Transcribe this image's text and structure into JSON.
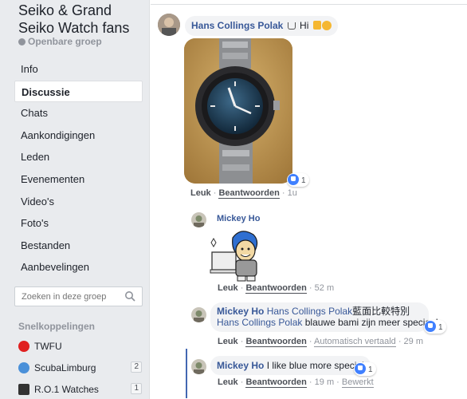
{
  "sidebar": {
    "group_title": "Seiko & Grand Seiko Watch fans",
    "group_type": "Openbare groep",
    "nav": [
      {
        "label": "Info",
        "active": false
      },
      {
        "label": "Discussie",
        "active": true
      },
      {
        "label": "Chats",
        "active": false
      },
      {
        "label": "Aankondigingen",
        "active": false
      },
      {
        "label": "Leden",
        "active": false
      },
      {
        "label": "Evenementen",
        "active": false
      },
      {
        "label": "Video's",
        "active": false
      },
      {
        "label": "Foto's",
        "active": false
      },
      {
        "label": "Bestanden",
        "active": false
      },
      {
        "label": "Aanbevelingen",
        "active": false
      }
    ],
    "search_placeholder": "Zoeken in deze groep",
    "shortcuts_heading": "Snelkoppelingen",
    "shortcuts": [
      {
        "label": "TWFU",
        "count": "",
        "color": "#e02020"
      },
      {
        "label": "ScubaLimburg",
        "count": "2",
        "color": "#4a90d9"
      },
      {
        "label": "R.O.1 Watches",
        "count": "1",
        "color": "#333333"
      }
    ]
  },
  "comments": {
    "c1": {
      "author": "Hans Collings Polak",
      "text": "Hi",
      "emoji": "☕ 👍😉",
      "reactions": "1",
      "like": "Leuk",
      "reply": "Beantwoorden",
      "time": "1u"
    },
    "c2": {
      "author": "Mickey Ho",
      "like": "Leuk",
      "reply": "Beantwoorden",
      "time": "52 m"
    },
    "c3": {
      "author": "Mickey Ho",
      "mention1": "Hans Collings Polak",
      "text1": "藍面比較特別",
      "mention2": "Hans Collings Polak",
      "text2": "blauwe bami zijn meer speciaal",
      "reactions": "1",
      "like": "Leuk",
      "reply": "Beantwoorden",
      "translated": "Automatisch vertaald",
      "time": "29 m"
    },
    "c4": {
      "author": "Mickey Ho",
      "text": "I like blue more special",
      "reactions": "1",
      "like": "Leuk",
      "reply": "Beantwoorden",
      "time": "19 m",
      "edited": "Bewerkt"
    }
  },
  "colors": {
    "link": "#385898",
    "sidebar_bg": "#e9ebee",
    "like_blue": "#4080ff",
    "bubble_bg": "#f2f3f5"
  }
}
